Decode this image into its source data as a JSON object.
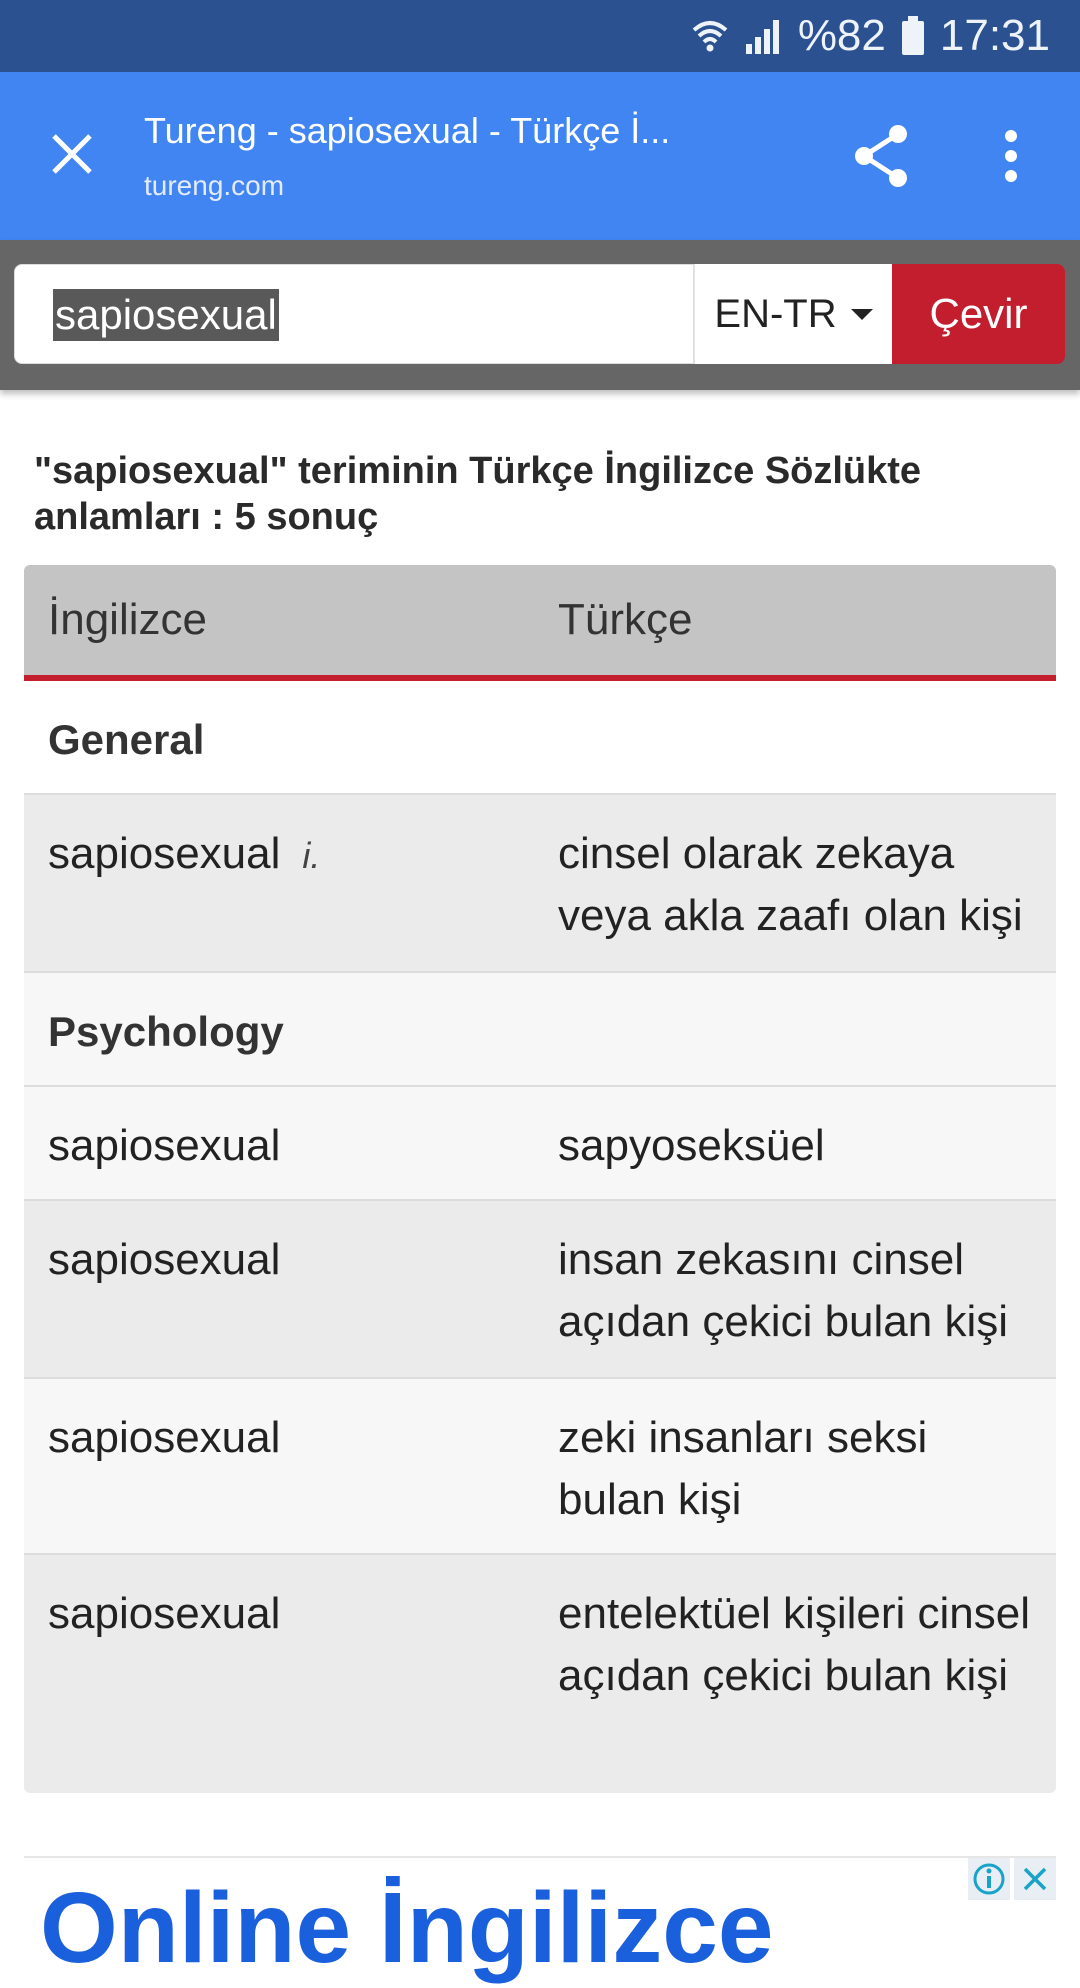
{
  "status_bar": {
    "battery": "%82",
    "time": "17:31"
  },
  "tab_bar": {
    "title": "Tureng - sapiosexual - Türkçe İ...",
    "domain": "tureng.com"
  },
  "search": {
    "value": "sapiosexual",
    "language": "EN-TR",
    "button_label": "Çevir"
  },
  "results": {
    "heading": "\"sapiosexual\" teriminin Türkçe İngilizce Sözlükte anlamları : 5 sonuç"
  },
  "table": {
    "headers": [
      "İngilizce",
      "Türkçe"
    ],
    "categories": [
      "General",
      "Psychology"
    ],
    "rows": [
      {
        "en": "sapiosexual",
        "pos": "i.",
        "tr": "cinsel olarak zekaya veya akla zaafı olan kişi"
      },
      {
        "en": "sapiosexual",
        "tr": "sapyoseksüel"
      },
      {
        "en": "sapiosexual",
        "tr": "insan zekasını cinsel açıdan çekici bulan kişi"
      },
      {
        "en": "sapiosexual",
        "tr": "zeki insanları seksi bulan kişi"
      },
      {
        "en": "sapiosexual",
        "tr": "entelektüel kişileri cinsel açıdan çekici bulan kişi"
      }
    ]
  },
  "ad": {
    "partial_text": "Online İngilizce"
  },
  "colors": {
    "status_bar": "#2b5190",
    "toolbar": "#4185f3",
    "accent_red": "#c21e2d",
    "search_bg": "#666666"
  },
  "icons": [
    "wifi-icon",
    "signal-icon",
    "battery-icon",
    "close-icon",
    "share-icon",
    "overflow-menu-icon",
    "caret-down-icon",
    "ad-info-icon",
    "ad-close-icon"
  ]
}
